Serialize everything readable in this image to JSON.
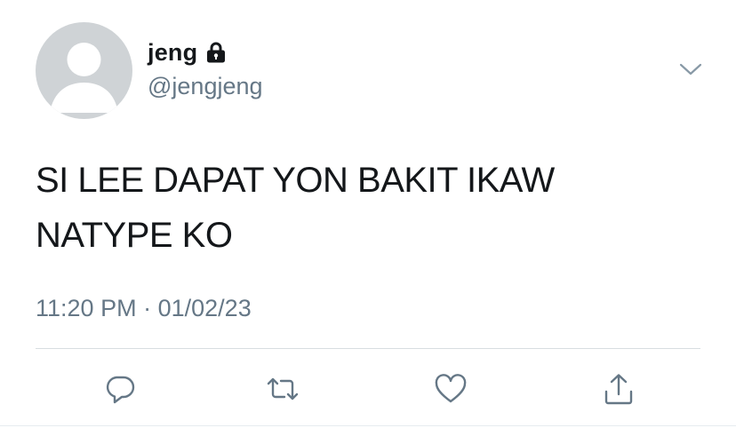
{
  "tweet": {
    "author": {
      "display_name": "jeng",
      "handle": "@jengjeng",
      "protected": true,
      "avatar": "default-avatar"
    },
    "text_lines": [
      "SI LEE DAPAT YON BAKIT IKAW",
      "NATYPE KO"
    ],
    "time": "11:20 PM",
    "separator": "·",
    "date": "01/02/23"
  },
  "icons": {
    "lock": "lock-icon",
    "menu": "chevron-down-icon",
    "reply": "reply-icon",
    "retweet": "retweet-icon",
    "like": "heart-icon",
    "share": "share-icon"
  },
  "colors": {
    "text": "#14171a",
    "secondary": "#657786",
    "avatar_bg": "#cfd3d6",
    "divider": "#d8dde1"
  }
}
